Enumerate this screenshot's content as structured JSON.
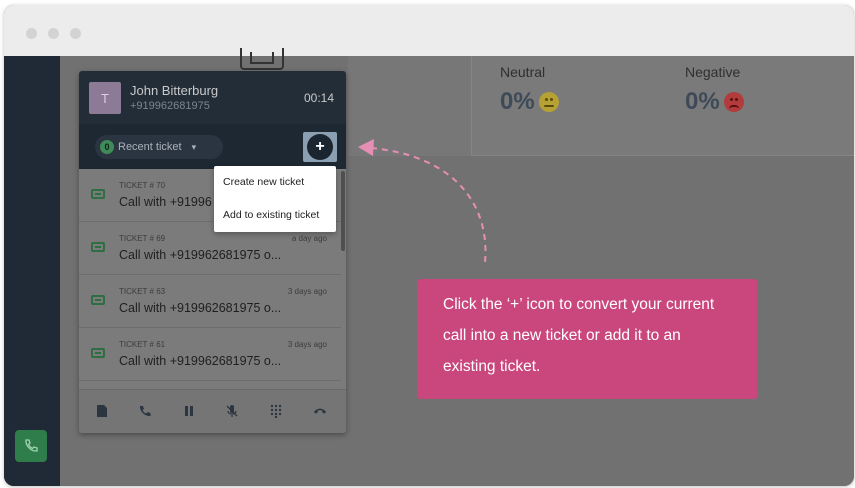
{
  "window": {
    "title": ""
  },
  "caller": {
    "avatar_initial": "T",
    "name": "John Bitterburg",
    "number": "+919962681975",
    "timer": "00:14"
  },
  "toolbar": {
    "recent_badge": "0",
    "recent_label": "Recent ticket",
    "recent_caret": "▾",
    "plus_label": "+"
  },
  "dropdown": {
    "items": [
      {
        "label": "Create new ticket"
      },
      {
        "label": "Add to existing ticket"
      }
    ]
  },
  "tickets": [
    {
      "number": "TICKET # 70",
      "time": "",
      "title": "Call with +91996"
    },
    {
      "number": "TICKET # 69",
      "time": "a day ago",
      "title": "Call with +919962681975 o..."
    },
    {
      "number": "TICKET # 63",
      "time": "3 days ago",
      "title": "Call with +919962681975 o..."
    },
    {
      "number": "TICKET # 61",
      "time": "3 days ago",
      "title": "Call with +919962681975 o..."
    }
  ],
  "sentiment": {
    "neutral_label": "Neutral",
    "neutral_value": "0%",
    "negative_label": "Negative",
    "negative_value": "0%"
  },
  "tooltip": {
    "text": "Click the ‘+’ icon to convert your current call into a new ticket or add it to an existing ticket."
  },
  "controls": [
    {
      "name": "notes-icon"
    },
    {
      "name": "transfer-call-icon"
    },
    {
      "name": "hold-icon"
    },
    {
      "name": "mute-icon"
    },
    {
      "name": "keypad-icon"
    },
    {
      "name": "hang-up-icon"
    }
  ],
  "colors": {
    "sidebar": "#1f2a36",
    "tooltip": "#c9477d",
    "arrow": "#e68fb4",
    "phone_button": "#2f7d4b"
  }
}
